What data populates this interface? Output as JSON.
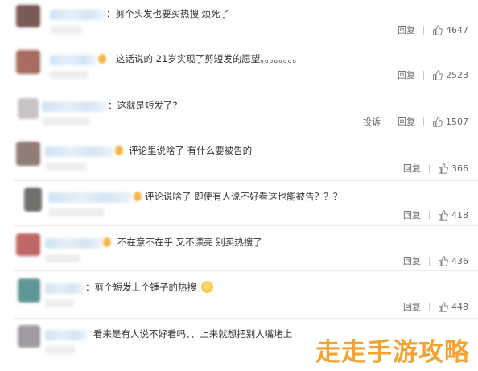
{
  "comments": [
    {
      "text": "：剪个头发也要买热搜 烦死了",
      "reply": "回复",
      "likes": "4647",
      "report": "",
      "avatar_color": "#7a5a56"
    },
    {
      "text": "这话说的 21岁实现了剪短发的愿望。。。。。。。。",
      "reply": "回复",
      "likes": "2523",
      "report": "",
      "avatar_color": "#a76d62"
    },
    {
      "text": "：这就是短发了?",
      "reply": "回复",
      "likes": "1507",
      "report": "投诉",
      "avatar_color": "#c9c2c7"
    },
    {
      "text": "评论里说啥了 有什么要被告的",
      "reply": "回复",
      "likes": "366",
      "report": "",
      "avatar_color": "#8f7d78"
    },
    {
      "text": "评论说啥了 即使有人说不好看这也能被告？？？",
      "reply": "回复",
      "likes": "418",
      "report": "",
      "avatar_color": "#6f6f6b"
    },
    {
      "text": "不在意不在乎 又不漂亮 别买热搜了",
      "reply": "回复",
      "likes": "436",
      "report": "",
      "avatar_color": "#c06767"
    },
    {
      "text": "：剪个短发上个锤子的热搜",
      "reply": "回复",
      "likes": "448",
      "report": "",
      "avatar_color": "#5f9796"
    },
    {
      "text": "看来是有人说不好看吗、、上来就想把别人嘴堵上",
      "reply": "",
      "likes": "",
      "report": "",
      "avatar_color": "#a19aa0"
    }
  ],
  "watermark": "走走手游攻略"
}
